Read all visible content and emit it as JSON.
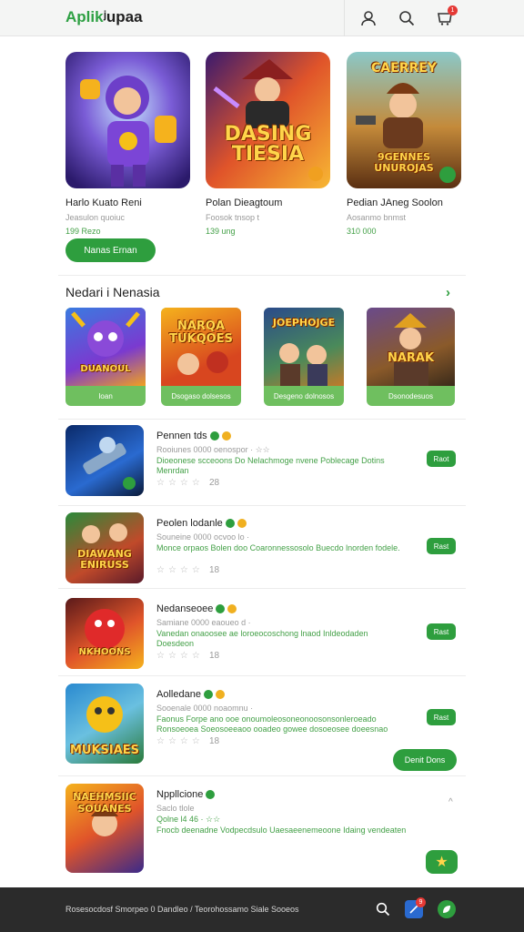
{
  "header": {
    "logo_brand": "Aplik",
    "logo_rest": "ʲupaa",
    "cart_badge": "1",
    "icons": [
      "user-icon",
      "search-icon",
      "cart-icon"
    ]
  },
  "featured": [
    {
      "title": "Harlo Kuato Reni",
      "subtitle": "Jeasulon quoiuc",
      "price": "199 Rezo"
    },
    {
      "title": "Polan Dieagtoum",
      "subtitle": "Foosok tnsop t",
      "price": "139 ung",
      "art_text": "DASING TIESIA"
    },
    {
      "title": "Pedian JAneg Soolon",
      "subtitle": "Aosanmo bnmst",
      "price": "310 000",
      "art_top": "CAERREY",
      "art_text": "9GENNES UNUROJAS"
    }
  ],
  "install_label": "Nanas Ernan",
  "section": {
    "title": "Nedari i Nenasia",
    "arrow": "›",
    "items": [
      {
        "label": "Ioan",
        "art_text": "DUANOUL"
      },
      {
        "label": "Dsogaso dolsesos",
        "art_text": "NARQA TUKQOES"
      },
      {
        "label": "Desgeno dolnosos",
        "art_text": "JOEPHOJGE"
      },
      {
        "label": "Dsonodesuos",
        "art_text": "NARAK"
      }
    ]
  },
  "list": [
    {
      "name": "Pennen tds",
      "meta": "Rooiunes 0000 oenospor · ☆☆",
      "desc1": "Dioeonese scceoons Do Nelachmoge nvene Poblecage Dotins",
      "desc2": "Menrdan",
      "stars": "☆☆☆☆",
      "rating": "28",
      "button": "Raot"
    },
    {
      "name": "Peolen lodanle",
      "meta": "Souneine 0000 ocvoo lo ·",
      "desc1": "Monce orpaos Bolen doo Coaronnessosolo Buecdo lnorden fodele.",
      "desc2": "",
      "stars": "☆☆☆☆",
      "rating": "18",
      "button": "Rast",
      "art_text": "DIAWANG ENIRUSS"
    },
    {
      "name": "Nedanseoee",
      "meta": "Samiane 0000 eaoueo d ·",
      "desc1": "Vanedan onaoosee ae loroeocoschong lnaod Inldeodaden",
      "desc2": "Doesdeon",
      "stars": "☆☆☆☆",
      "rating": "18",
      "button": "Rast",
      "art_text": "NKHOONS"
    },
    {
      "name": "Aolledane",
      "meta": "Sooenale 0000 noaomnu ·",
      "desc1": "Faonus Forpe ano ooe onoumoleosoneonoosonsonleroeado",
      "desc2": "Ronsoeoea Soeosoeeaoo ooadeo gowee dosoeosee doeesnao",
      "stars": "☆☆☆☆",
      "rating": "18",
      "button": "Rast",
      "pill": "Denit Dons",
      "art_text": "MUKSIAES"
    },
    {
      "name": "Nppllcione",
      "meta": "Saclo tlole",
      "meta2": "Qolne l4 46 · ☆☆",
      "desc1": "Fnocb deenadne Vodpecdsulo Uaesaeenemeoone Idaing vendeaten",
      "art_text": "NAEHMSIIC SOUANES"
    }
  ],
  "footer": {
    "text": "Rosesocdosf Smorpeo 0 Dandleo / Teorohossamo Siale Sooeos",
    "icons": [
      "search-icon",
      "notification-icon",
      "leaf-icon"
    ],
    "badge": "9"
  },
  "colors": {
    "accent_green": "#2e9e3e",
    "footer_bg": "#2b2b2b",
    "header_bg": "#f4f5f4"
  }
}
